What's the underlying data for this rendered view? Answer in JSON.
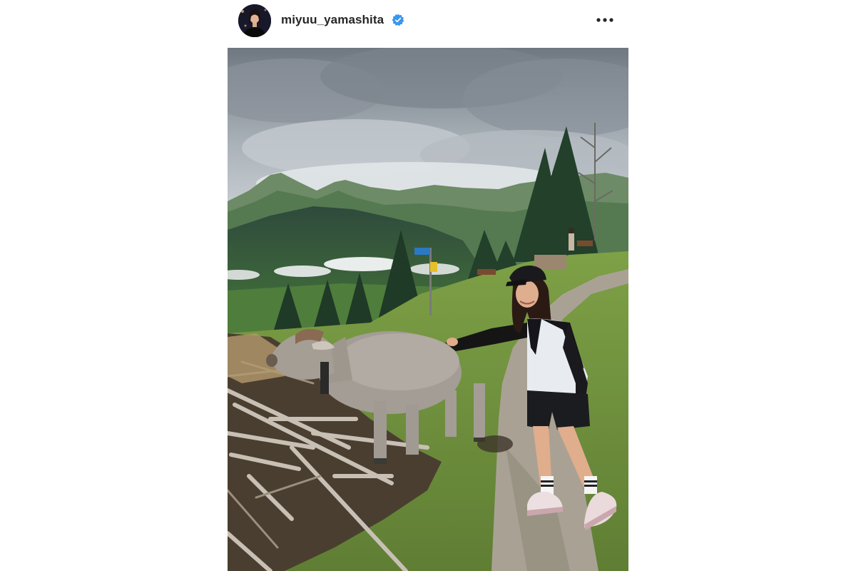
{
  "post": {
    "author": {
      "username": "miyuu_yamashita",
      "avatar_icon": "profile-photo",
      "verified": true,
      "verified_icon": "verified-badge-icon",
      "verified_color": "#3897f0"
    },
    "menu_icon": "more-options-icon",
    "photo": {
      "subject": "woman-petting-calf-on-alpine-trail"
    }
  }
}
